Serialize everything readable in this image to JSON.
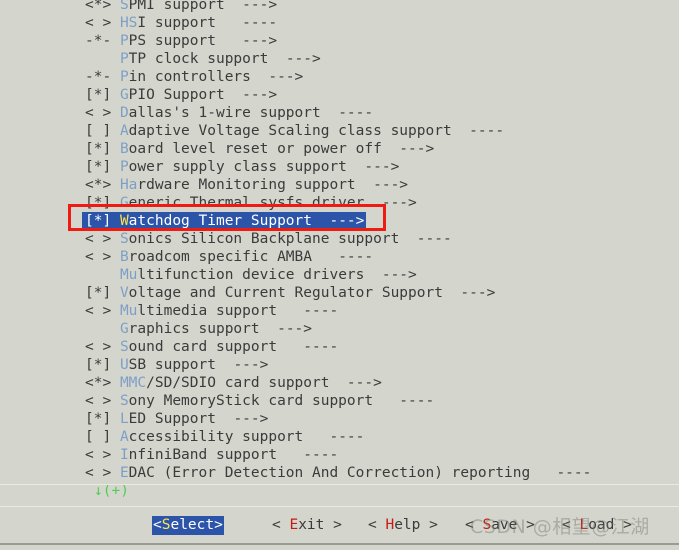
{
  "app": {
    "title": "Linux Kernel Configuration (menuconfig)",
    "background_color": "#d4d6cd",
    "text_color": "#3b3b3b",
    "hotkey_color": "#7d9fc6",
    "selection_bg_color": "#2c54a8",
    "selection_fg_color": "#ffffff",
    "selection_hotkey_color": "#ffe34d",
    "annotation_box_color": "#ee1b13",
    "scroll_indicator_color": "#55cc55"
  },
  "menu": {
    "rows": [
      {
        "mark": "<*>",
        "hot": "S",
        "label": "PMI support",
        "arrow": "  --->",
        "selected": false
      },
      {
        "mark": "< >",
        "hot": "HS",
        "label": "I support",
        "arrow": "   ----",
        "selected": false
      },
      {
        "mark": "-*-",
        "hot": "P",
        "label": "PS support",
        "arrow": "   --->",
        "selected": false
      },
      {
        "mark": "   ",
        "hot": "P",
        "label": "TP clock support",
        "arrow": "  --->",
        "selected": false
      },
      {
        "mark": "-*-",
        "hot": "P",
        "label": "in controllers",
        "arrow": "  --->",
        "selected": false
      },
      {
        "mark": "[*]",
        "hot": "G",
        "label": "PIO Support",
        "arrow": "  --->",
        "selected": false
      },
      {
        "mark": "< >",
        "hot": "D",
        "label": "allas's 1-wire support",
        "arrow": "  ----",
        "selected": false
      },
      {
        "mark": "[ ]",
        "hot": "A",
        "label": "daptive Voltage Scaling class support",
        "arrow": "  ----",
        "selected": false
      },
      {
        "mark": "[*]",
        "hot": "B",
        "label": "oard level reset or power off",
        "arrow": "  --->",
        "selected": false
      },
      {
        "mark": "[*]",
        "hot": "P",
        "label": "ower supply class support",
        "arrow": "  --->",
        "selected": false
      },
      {
        "mark": "<*>",
        "hot": "Ha",
        "label": "rdware Monitoring support",
        "arrow": "  --->",
        "selected": false
      },
      {
        "mark": "[*]",
        "hot": "G",
        "label": "eneric Thermal sysfs driver",
        "arrow": "  --->",
        "selected": false
      },
      {
        "mark": "[*]",
        "hot": "W",
        "label": "atchdog Timer Support",
        "arrow": "  --->",
        "selected": true
      },
      {
        "mark": "< >",
        "hot": "S",
        "label": "onics Silicon Backplane support",
        "arrow": "  ----",
        "selected": false
      },
      {
        "mark": "< >",
        "hot": "B",
        "label": "roadcom specific AMBA",
        "arrow": "   ----",
        "selected": false
      },
      {
        "mark": "   ",
        "hot": "Mu",
        "label": "ltifunction device drivers",
        "arrow": "  --->",
        "selected": false
      },
      {
        "mark": "[*]",
        "hot": "V",
        "label": "oltage and Current Regulator Support",
        "arrow": "  --->",
        "selected": false
      },
      {
        "mark": "< >",
        "hot": "Mu",
        "label": "ltimedia support",
        "arrow": "   ----",
        "selected": false
      },
      {
        "mark": "   ",
        "hot": "G",
        "label": "raphics support",
        "arrow": "  --->",
        "selected": false
      },
      {
        "mark": "< >",
        "hot": "S",
        "label": "ound card support",
        "arrow": "   ----",
        "selected": false
      },
      {
        "mark": "[*]",
        "hot": "U",
        "label": "SB support",
        "arrow": "  --->",
        "selected": false
      },
      {
        "mark": "<*>",
        "hot": "MMC",
        "label": "/SD/SDIO card support",
        "arrow": "  --->",
        "selected": false
      },
      {
        "mark": "< >",
        "hot": "S",
        "label": "ony MemoryStick card support",
        "arrow": "   ----",
        "selected": false
      },
      {
        "mark": "[*]",
        "hot": "L",
        "label": "ED Support",
        "arrow": "  --->",
        "selected": false
      },
      {
        "mark": "[ ]",
        "hot": "A",
        "label": "ccessibility support",
        "arrow": "   ----",
        "selected": false
      },
      {
        "mark": "< >",
        "hot": "I",
        "label": "nfiniBand support",
        "arrow": "   ----",
        "selected": false
      },
      {
        "mark": "< >",
        "hot": "E",
        "label": "DAC (Error Detection And Correction) reporting",
        "arrow": "   ----",
        "selected": false
      }
    ],
    "scroll_indicator": "↓(+)"
  },
  "buttons": {
    "select": {
      "pre": "<",
      "hot": "S",
      "post": "elect>",
      "active": true
    },
    "exit": {
      "pre": "< ",
      "hot": "E",
      "post": "xit >",
      "active": false
    },
    "help": {
      "pre": "< ",
      "hot": "H",
      "post": "elp >",
      "active": false
    },
    "save": {
      "pre": "< ",
      "hot": "S",
      "post": "ave >",
      "active": false
    },
    "load": {
      "pre": "< ",
      "hot": "L",
      "post": "oad >",
      "active": false
    }
  },
  "watermark": {
    "prefix": "CSDN @相望@",
    "red": "",
    "suffix": "江湖",
    "full": "CSDN @相望@江湖"
  }
}
